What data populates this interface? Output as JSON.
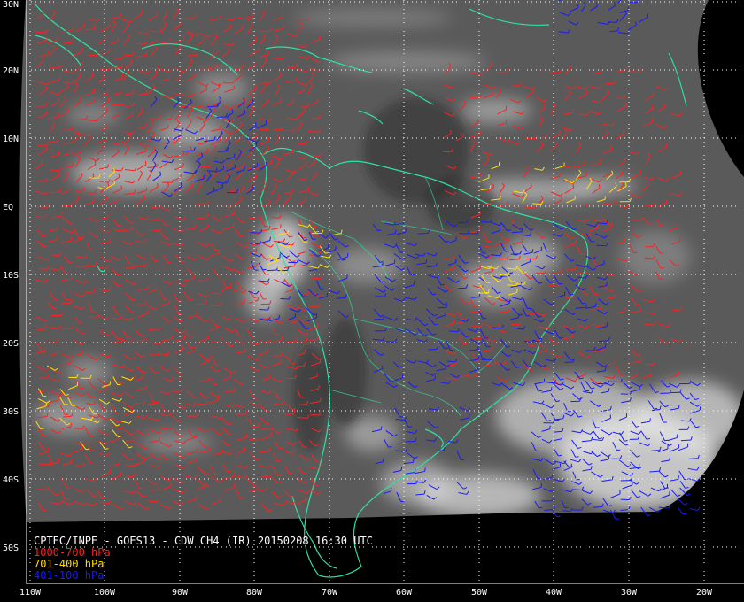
{
  "title": "CPTEC/INPE - GOES13 - CDW CH4 (IR) 20150208 16:30 UTC",
  "legend": [
    {
      "label": "1000-700 hPa",
      "color": "#ff2020"
    },
    {
      "label": "701-400 hPa",
      "color": "#ffe000"
    },
    {
      "label": "401-100 hPa",
      "color": "#1a1aff"
    }
  ],
  "lat_labels": [
    "30N",
    "20N",
    "10N",
    "EQ",
    "10S",
    "20S",
    "30S",
    "40S",
    "50S"
  ],
  "lon_labels": [
    "110W",
    "100W",
    "90W",
    "80W",
    "70W",
    "60W",
    "50W",
    "40W",
    "30W",
    "20W"
  ],
  "colors": {
    "background": "#000000",
    "coastline": "#2fe0a0",
    "grid": "#ffffff",
    "imagery_base": "#5a5a5a",
    "cloud": "#e8e8e8"
  }
}
